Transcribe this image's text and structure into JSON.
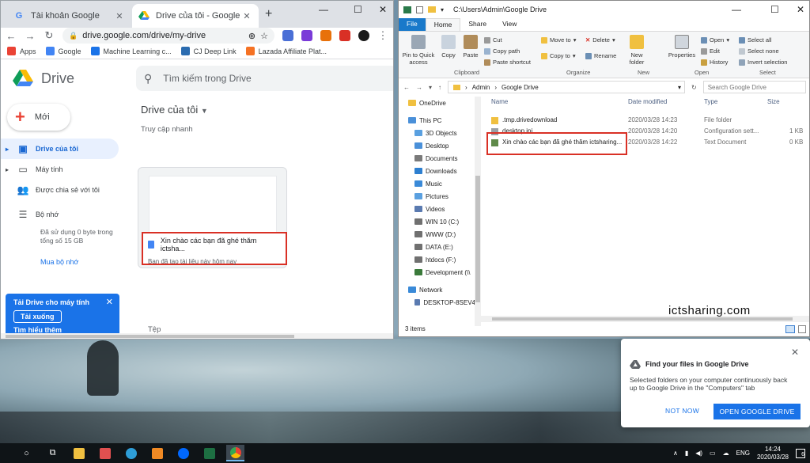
{
  "chrome": {
    "tabs": [
      {
        "label": "Tài khoản Google",
        "icon": "google-g-icon"
      },
      {
        "label": "Drive của tôi - Google Drive",
        "icon": "drive-icon"
      }
    ],
    "url": "drive.google.com/drive/my-drive",
    "bookmarks": [
      {
        "label": "Apps",
        "color": "#ea4335"
      },
      {
        "label": "Google",
        "color": "#4285f4"
      },
      {
        "label": "Machine Learning c...",
        "color": "#1a73e8"
      },
      {
        "label": "CJ Deep Link",
        "color": "#2b6cb0"
      },
      {
        "label": "Lazada Affiliate Plat...",
        "color": "#f57224"
      }
    ]
  },
  "drive": {
    "app_name": "Drive",
    "search_placeholder": "Tìm kiếm trong Drive",
    "new_label": "Mới",
    "nav": [
      {
        "label": "Drive của tôi",
        "icon": "my-drive-icon",
        "active": true
      },
      {
        "label": "Máy tính",
        "icon": "computer-icon"
      },
      {
        "label": "Được chia sẻ với tôi",
        "icon": "shared-icon"
      },
      {
        "label": "Bộ nhớ",
        "icon": "storage-icon"
      }
    ],
    "storage_text_1": "Đã sử dụng 0 byte trong",
    "storage_text_2": "tổng số 15 GB",
    "buy_storage": "Mua bộ nhớ",
    "promo": {
      "title": "Tải Drive cho máy tính",
      "download": "Tải xuống",
      "learn_more": "Tìm hiểu thêm"
    },
    "heading": "Drive của tôi",
    "quick_access": "Truy cập nhanh",
    "quick_file": {
      "name": "Xin chào các bạn đã ghé thăm ictsha...",
      "subtitle": "Bạn đã tạo tài liệu này hôm nay"
    },
    "files_label": "Tệp"
  },
  "explorer": {
    "title_path": "C:\\Users\\Admin\\Google Drive",
    "ribbon_tabs": [
      "File",
      "Home",
      "Share",
      "View"
    ],
    "clipboard": {
      "pin": "Pin to Quick access",
      "copy": "Copy",
      "paste": "Paste",
      "cut": "Cut",
      "copy_path": "Copy path",
      "paste_shortcut": "Paste shortcut",
      "label": "Clipboard"
    },
    "organize": {
      "move_to": "Move to",
      "copy_to": "Copy to",
      "delete": "Delete",
      "rename": "Rename",
      "label": "Organize"
    },
    "new": {
      "new_folder": "New folder",
      "label": "New"
    },
    "open": {
      "properties": "Properties",
      "open": "Open",
      "edit": "Edit",
      "history": "History",
      "label": "Open"
    },
    "select": {
      "select_all": "Select all",
      "select_none": "Select none",
      "invert": "Invert selection",
      "label": "Select"
    },
    "breadcrumb": [
      "Admin",
      "Google Drive"
    ],
    "search_placeholder": "Search Google Drive",
    "nav_pane": [
      {
        "label": "OneDrive",
        "color": "#f0c040"
      },
      {
        "label": "This PC",
        "color": "#4a90d9"
      },
      {
        "label": "3D Objects",
        "color": "#5aa0e0"
      },
      {
        "label": "Desktop",
        "color": "#4a90d9"
      },
      {
        "label": "Documents",
        "color": "#7a7a7a"
      },
      {
        "label": "Downloads",
        "color": "#2d7fd0"
      },
      {
        "label": "Music",
        "color": "#3a8ad8"
      },
      {
        "label": "Pictures",
        "color": "#5aa0e0"
      },
      {
        "label": "Videos",
        "color": "#5a7ab0"
      },
      {
        "label": "WIN 10 (C:)",
        "color": "#707070"
      },
      {
        "label": "WWW (D:)",
        "color": "#707070"
      },
      {
        "label": "DATA (E:)",
        "color": "#707070"
      },
      {
        "label": "htdocs (F:)",
        "color": "#707070"
      },
      {
        "label": "Development (\\\\",
        "color": "#3a7a3a"
      },
      {
        "label": "Network",
        "color": "#3a8ad8"
      },
      {
        "label": "DESKTOP-8SEV4",
        "color": "#5a7ab0"
      }
    ],
    "columns": [
      "Name",
      "Date modified",
      "Type",
      "Size"
    ],
    "rows": [
      {
        "name": ".tmp.drivedownload",
        "date": "2020/03/28 14:23",
        "type": "File folder",
        "size": ""
      },
      {
        "name": "desktop.ini",
        "date": "2020/03/28 14:20",
        "type": "Configuration sett...",
        "size": "1 KB"
      },
      {
        "name": "Xin chào các bạn đã ghé thăm ictsharing...",
        "date": "2020/03/28 14:22",
        "type": "Text Document",
        "size": "0 KB"
      }
    ],
    "status": "3 items"
  },
  "watermark": "ictsharing.com",
  "notification": {
    "title": "Find your files in Google Drive",
    "body": "Selected folders on your computer continuously back up to Google Drive in the \"Computers\" tab",
    "not_now": "NOT NOW",
    "open": "OPEN GOOGLE DRIVE"
  },
  "taskbar": {
    "language": "ENG",
    "time": "14:24",
    "date": "2020/03/28",
    "notifications": "6"
  }
}
